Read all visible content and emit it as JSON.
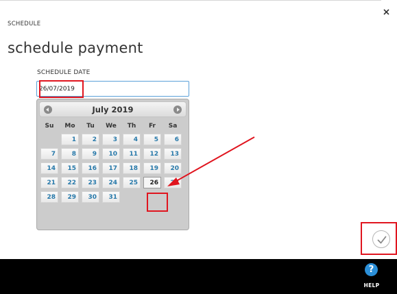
{
  "dialog": {
    "eyebrow": "SCHEDULE",
    "title": "schedule payment",
    "close_glyph": "×"
  },
  "form": {
    "date_label": "SCHEDULE DATE",
    "date_value": "26/07/2019"
  },
  "datepicker": {
    "month_title": "July 2019",
    "weekdays": [
      "Su",
      "Mo",
      "Tu",
      "We",
      "Th",
      "Fr",
      "Sa"
    ],
    "days": [
      "1",
      "2",
      "3",
      "4",
      "5",
      "6",
      "7",
      "8",
      "9",
      "10",
      "11",
      "12",
      "13",
      "14",
      "15",
      "16",
      "17",
      "18",
      "19",
      "20",
      "21",
      "22",
      "23",
      "24",
      "25",
      "26",
      "27",
      "28",
      "29",
      "30",
      "31"
    ],
    "selected_day": "26"
  },
  "footer": {
    "help_glyph": "?",
    "help_label": "HELP"
  },
  "colors": {
    "annotation": "#e0141e",
    "day_link": "#2779aa",
    "help_icon": "#2b8fd8"
  }
}
